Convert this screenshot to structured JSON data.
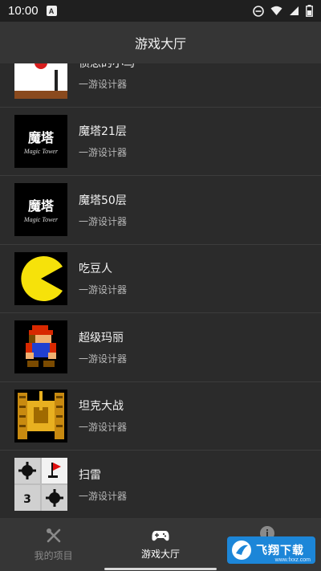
{
  "status_bar": {
    "time": "10:00",
    "notification_letter": "A"
  },
  "app_bar": {
    "title": "游戏大厅"
  },
  "games": [
    {
      "title": "愤怒的小鸟",
      "subtitle": "一游设计器",
      "thumb": "angry-birds-thumbnail"
    },
    {
      "title": "魔塔21层",
      "subtitle": "一游设计器",
      "thumb": "magic-tower-21-thumbnail",
      "logo_text": "魔塔",
      "logo_sub": "Magic Tower"
    },
    {
      "title": "魔塔50层",
      "subtitle": "一游设计器",
      "thumb": "magic-tower-50-thumbnail",
      "logo_text": "魔塔",
      "logo_sub": "Magic Tower"
    },
    {
      "title": "吃豆人",
      "subtitle": "一游设计器",
      "thumb": "pacman-thumbnail"
    },
    {
      "title": "超级玛丽",
      "subtitle": "一游设计器",
      "thumb": "super-mario-thumbnail"
    },
    {
      "title": "坦克大战",
      "subtitle": "一游设计器",
      "thumb": "tank-battle-thumbnail"
    },
    {
      "title": "扫雷",
      "subtitle": "一游设计器",
      "thumb": "minesweeper-thumbnail",
      "cell_number": "3"
    }
  ],
  "tabs": [
    {
      "label": "我的项目",
      "icon": "tools-icon",
      "active": false
    },
    {
      "label": "游戏大厅",
      "icon": "gamepad-icon",
      "active": true
    },
    {
      "label": "",
      "icon": "info-icon",
      "active": false
    }
  ],
  "watermark": {
    "text": "飞翔下载",
    "sub": "www.fxxz.com"
  },
  "colors": {
    "background": "#2b2b2b",
    "app_bar": "#353535",
    "tab_bar": "#363636",
    "status_bar": "#1f1f1f",
    "watermark": "#1c86d8"
  }
}
